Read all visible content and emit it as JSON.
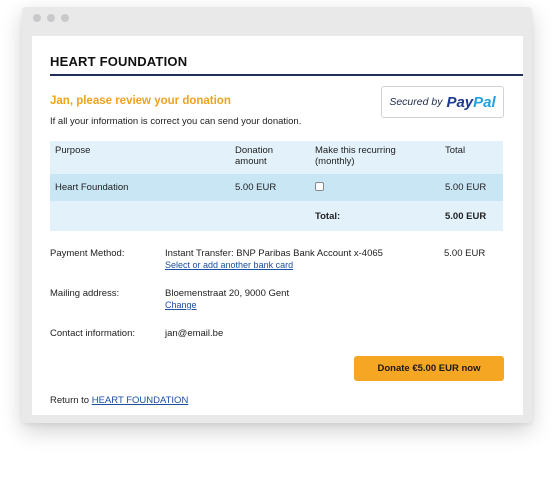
{
  "header": {
    "org_title": "HEART FOUNDATION"
  },
  "review": {
    "title": "Jan, please review your donation",
    "subtitle": "If all your information is correct you can send your donation."
  },
  "paypal": {
    "secured_by": "Secured by",
    "pay": "Pay",
    "pal": "Pal"
  },
  "table": {
    "headers": {
      "purpose": "Purpose",
      "amount": "Donation amount",
      "recurring": "Make this recurring (monthly)",
      "total": "Total"
    },
    "item": {
      "purpose": "Heart Foundation",
      "amount": "5.00 EUR",
      "total": "5.00 EUR",
      "recurring_checked": false
    },
    "total_row": {
      "label": "Total:",
      "value": "5.00 EUR"
    }
  },
  "payment": {
    "label": "Payment Method:",
    "value": "Instant Transfer: BNP Paribas Bank Account x-4065",
    "link": "Select or add another bank card",
    "amount": "5.00 EUR"
  },
  "mailing": {
    "label": "Mailing address:",
    "value": "Bloemenstraat 20, 9000 Gent",
    "link": "Change"
  },
  "contact": {
    "label": "Contact information:",
    "value": "jan@email.be"
  },
  "donate_button": "Donate €5.00 EUR now",
  "return": {
    "prefix": "Return to",
    "link": "HEART FOUNDATION"
  },
  "colors": {
    "accent_orange": "#f0a21c",
    "button": "#f5a623",
    "header_rule": "#1f2f55",
    "paypal_blue": "#1c3b8f",
    "paypal_light": "#1fa2e1"
  }
}
